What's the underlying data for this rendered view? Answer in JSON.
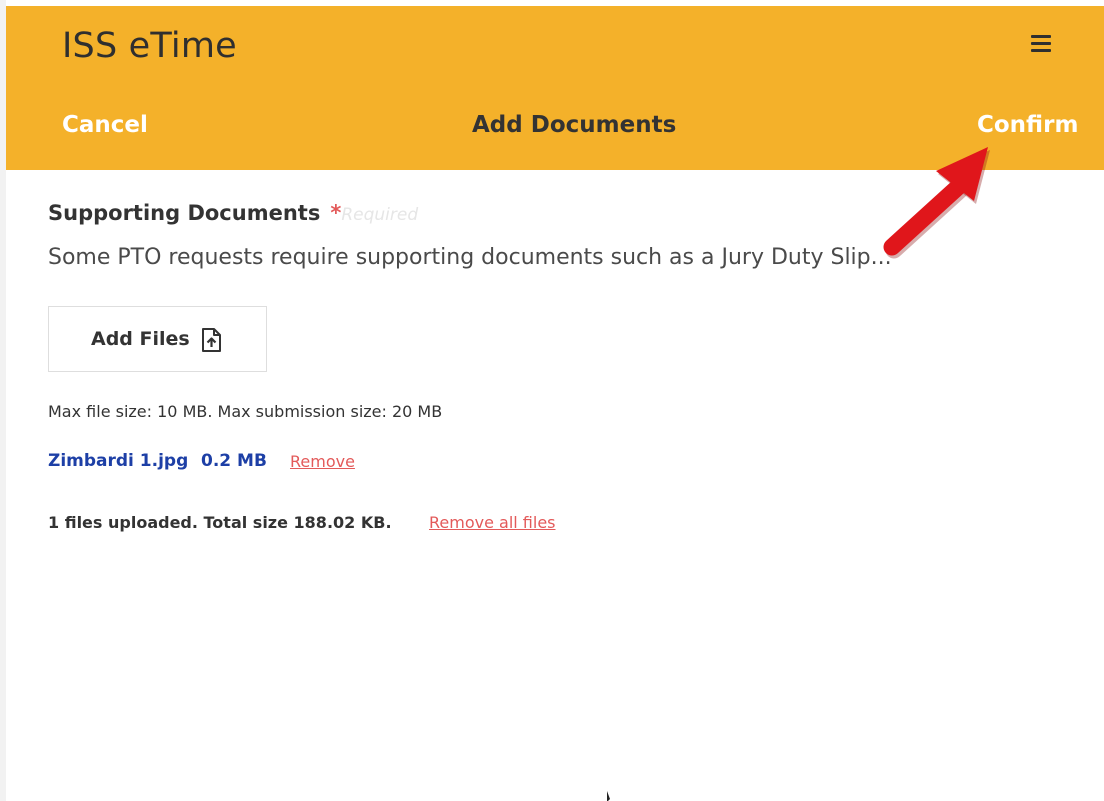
{
  "app": {
    "title": "ISS eTime",
    "menu_icon": "hamburger-menu-icon"
  },
  "nav": {
    "cancel_label": "Cancel",
    "title": "Add Documents",
    "confirm_label": "Confirm"
  },
  "section": {
    "heading": "Supporting Documents",
    "required_marker": "*",
    "required_label": "Required",
    "description": "Some PTO requests require supporting documents such as a Jury Duty Slip..."
  },
  "upload": {
    "button_label": "Add Files",
    "button_icon": "file-upload-icon",
    "limits": "Max file size: 10 MB. Max submission size: 20 MB"
  },
  "files": [
    {
      "name": "Zimbardi 1.jpg",
      "size": "0.2 MB",
      "remove_label": "Remove"
    }
  ],
  "summary": {
    "text": "1 files uploaded. Total size 188.02 KB.",
    "remove_all_label": "Remove all files"
  },
  "colors": {
    "header_background": "#f4b12a",
    "file_link": "#1d3fa6",
    "remove_link": "#e35a5a",
    "annotation_arrow": "#e0161b"
  },
  "annotation": {
    "arrow_icon": "red-arrow-pointing-to-confirm"
  }
}
